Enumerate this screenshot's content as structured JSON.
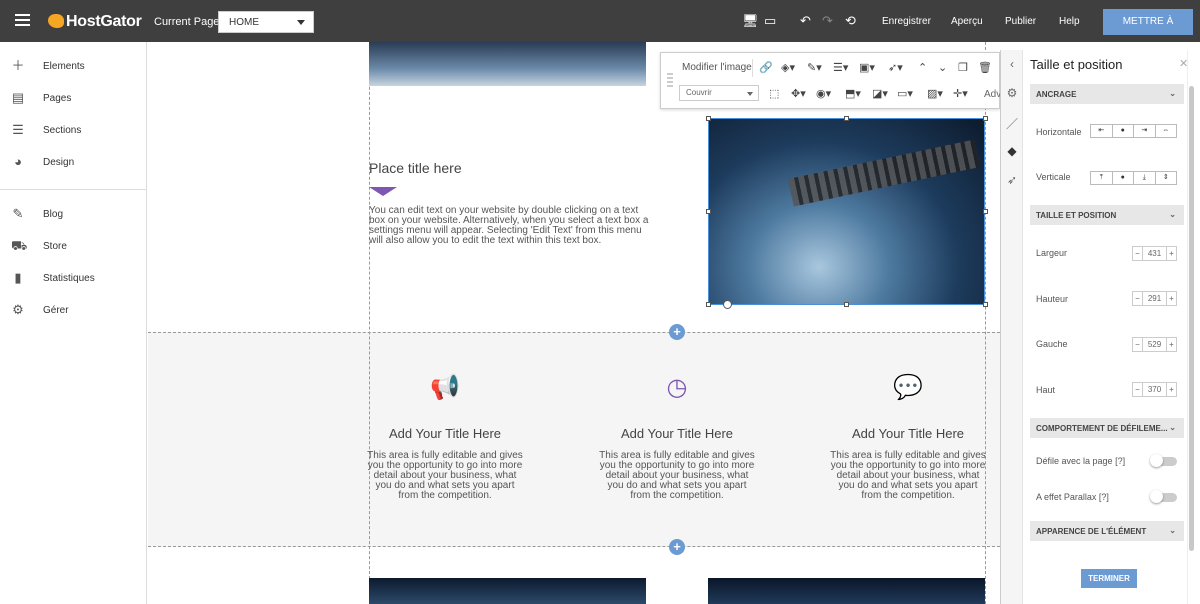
{
  "topbar": {
    "logo": "HostGator",
    "current_page_label": "Current Page:",
    "current_page_value": "HOME",
    "save": "Enregistrer",
    "preview": "Aperçu",
    "publish": "Publier",
    "help": "Help",
    "upgrade": "METTRE À NIVEAU",
    "icons": [
      "hamburger-icon",
      "desktop-icon",
      "mobile-icon",
      "undo-icon",
      "redo-icon",
      "history-icon"
    ]
  },
  "sidebar": {
    "items": [
      {
        "label": "Elements",
        "icon": "plus-icon"
      },
      {
        "label": "Pages",
        "icon": "pages-icon"
      },
      {
        "label": "Sections",
        "icon": "sections-icon"
      },
      {
        "label": "Design",
        "icon": "palette-icon"
      },
      {
        "label": "Blog",
        "icon": "pencil-icon"
      },
      {
        "label": "Store",
        "icon": "cart-icon"
      },
      {
        "label": "Statistiques",
        "icon": "bar-chart-icon"
      },
      {
        "label": "Gérer",
        "icon": "gear-icon"
      }
    ]
  },
  "canvas": {
    "place_title": "Place title here",
    "place_text": "You can edit text on your website by double clicking on a text box on your website. Alternatively, when you select a text box a settings menu will appear. Selecting 'Edit Text' from this menu will also allow you to edit the text within this text box.",
    "features": [
      {
        "icon": "megaphone-icon",
        "title": "Add Your Title Here",
        "text": "This area is fully editable and gives you the opportunity to go into more detail about your business, what you do and what sets you apart from the competition."
      },
      {
        "icon": "clock-icon",
        "title": "Add Your Title Here",
        "text": "This area is fully editable and gives you the opportunity to go into more detail about your business, what you do and what sets you apart from the competition."
      },
      {
        "icon": "chat-icon",
        "title": "Add Your Title Here",
        "text": "This area is fully editable and gives you the opportunity to go into more detail about your business, what you do and what sets you apart from the competition."
      }
    ]
  },
  "image_toolbar": {
    "edit_image": "Modifier l'image",
    "fit_select": "Couvrir",
    "advanced_partial": "Adv"
  },
  "panel": {
    "title": "Taille et position",
    "sections": {
      "anchor": "ANCRAGE",
      "size_position": "TAILLE ET POSITION",
      "scroll_behavior": "COMPORTEMENT DE DÉFILEME...",
      "appearance": "APPARENCE DE L'ÉLÉMENT"
    },
    "anchor": {
      "horizontal_label": "Horizontale",
      "vertical_label": "Verticale"
    },
    "fields": {
      "width_label": "Largeur",
      "width": "431",
      "height_label": "Hauteur",
      "height": "291",
      "left_label": "Gauche",
      "left": "529",
      "top_label": "Haut",
      "top": "370"
    },
    "scroll": {
      "scroll_with_page": "Défile avec la page",
      "parallax": "A effet Parallax",
      "help": "[?]"
    },
    "finish": "TERMINER"
  },
  "colors": {
    "topbar": "#3f3f3f",
    "accent": "#6b9bd2",
    "purple": "#7d57b1"
  }
}
